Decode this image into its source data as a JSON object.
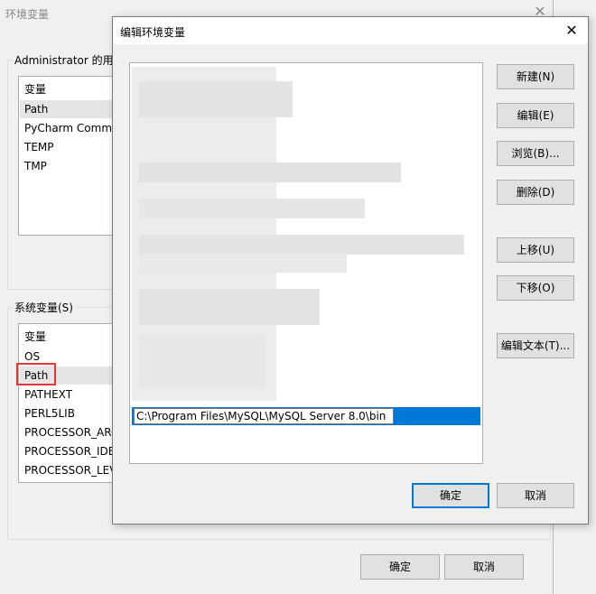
{
  "bg_window": {
    "title": "环境变量",
    "close": "✕",
    "user_group_label": "Administrator 的用户变量(U)",
    "user_list": {
      "header": "变量",
      "rows": [
        "Path",
        "PyCharm Community Edition",
        "TEMP",
        "TMP"
      ]
    },
    "system_group_label": "系统变量(S)",
    "system_list": {
      "header": "变量",
      "rows": [
        "OS",
        "Path",
        "PATHEXT",
        "PERL5LIB",
        "PROCESSOR_ARCHITECTURE",
        "PROCESSOR_IDENTIFIER",
        "PROCESSOR_LEVEL"
      ]
    },
    "ok_label": "确定",
    "cancel_label": "取消"
  },
  "dialog": {
    "title": "编辑环境变量",
    "close": "✕",
    "edit_value": "C:\\Program Files\\MySQL\\MySQL Server 8.0\\bin",
    "buttons": {
      "new": "新建(N)",
      "edit": "编辑(E)",
      "browse": "浏览(B)...",
      "delete": "删除(D)",
      "move_up": "上移(U)",
      "move_down": "下移(O)",
      "edit_text": "编辑文本(T)..."
    },
    "ok_label": "确定",
    "cancel_label": "取消"
  },
  "colors": {
    "selection_blue": "#0078d7",
    "highlight_red": "#e53935"
  }
}
